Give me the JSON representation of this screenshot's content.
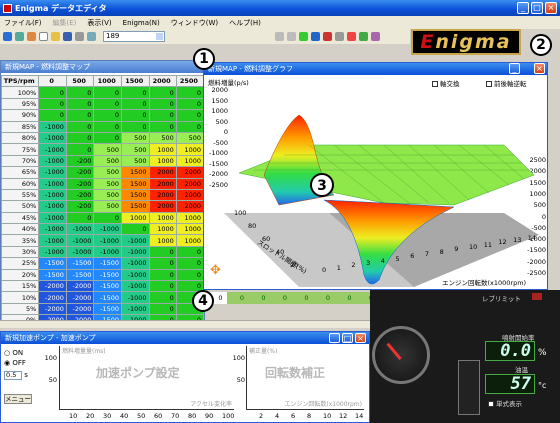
{
  "app": {
    "title": "Enigma データエディタ"
  },
  "menu": [
    {
      "label": "ファイル(F)",
      "disabled": false
    },
    {
      "label": "編集(E)",
      "disabled": true
    },
    {
      "label": "表示(V)",
      "disabled": false
    },
    {
      "label": "Enigma(N)",
      "disabled": false
    },
    {
      "label": "ウィンドウ(W)",
      "disabled": false
    },
    {
      "label": "ヘルプ(H)",
      "disabled": false
    }
  ],
  "toolbar": {
    "combo_value": "189"
  },
  "logo": {
    "text_a": "E",
    "text_b": "nigma"
  },
  "fuel_map": {
    "title": "新規MAP - 燃料調整マップ",
    "corner": "TPS/rpm",
    "columns": [
      "0",
      "500",
      "1000",
      "1500",
      "2000",
      "2500"
    ],
    "rows": [
      {
        "label": "100%",
        "cells": [
          "0",
          "0",
          "0",
          "0",
          "0",
          "0"
        ]
      },
      {
        "label": "95%",
        "cells": [
          "0",
          "0",
          "0",
          "0",
          "0",
          "0"
        ]
      },
      {
        "label": "90%",
        "cells": [
          "0",
          "0",
          "0",
          "0",
          "0",
          "0"
        ]
      },
      {
        "label": "85%",
        "cells": [
          "-1000",
          "0",
          "0",
          "0",
          "0",
          "0"
        ]
      },
      {
        "label": "80%",
        "cells": [
          "-1000",
          "0",
          "0",
          "500",
          "500",
          "500"
        ]
      },
      {
        "label": "75%",
        "cells": [
          "-1000",
          "0",
          "500",
          "500",
          "1000",
          "1000"
        ]
      },
      {
        "label": "70%",
        "cells": [
          "-1000",
          "-200",
          "500",
          "500",
          "1000",
          "1000"
        ]
      },
      {
        "label": "65%",
        "cells": [
          "-1000",
          "-200",
          "500",
          "1500",
          "2000",
          "2000"
        ]
      },
      {
        "label": "60%",
        "cells": [
          "-1000",
          "-200",
          "500",
          "1500",
          "2000",
          "2000"
        ]
      },
      {
        "label": "55%",
        "cells": [
          "-1000",
          "-200",
          "500",
          "1500",
          "2000",
          "2000"
        ]
      },
      {
        "label": "50%",
        "cells": [
          "-1000",
          "-200",
          "500",
          "1500",
          "2000",
          "2000"
        ]
      },
      {
        "label": "45%",
        "cells": [
          "-1000",
          "0",
          "0",
          "1000",
          "1000",
          "1000"
        ]
      },
      {
        "label": "40%",
        "cells": [
          "-1000",
          "-1000",
          "-1000",
          "0",
          "1000",
          "1000"
        ]
      },
      {
        "label": "35%",
        "cells": [
          "-1000",
          "-1000",
          "-1000",
          "-1000",
          "1000",
          "1000"
        ]
      },
      {
        "label": "30%",
        "cells": [
          "-1000",
          "-1000",
          "-1000",
          "-1000",
          "0",
          "0"
        ]
      },
      {
        "label": "25%",
        "cells": [
          "-1500",
          "-1500",
          "-1500",
          "-1000",
          "0",
          "0"
        ]
      },
      {
        "label": "20%",
        "cells": [
          "-1500",
          "-1500",
          "-1500",
          "-1000",
          "0",
          "0"
        ]
      },
      {
        "label": "15%",
        "cells": [
          "-2000",
          "-2000",
          "-1500",
          "-1000",
          "0",
          "0"
        ]
      },
      {
        "label": "10%",
        "cells": [
          "-2000",
          "-2000",
          "-1500",
          "-1000",
          "0",
          "0"
        ]
      },
      {
        "label": "5%",
        "cells": [
          "-2000",
          "-2000",
          "-1500",
          "-1000",
          "0",
          "0"
        ]
      },
      {
        "label": "0%",
        "cells": [
          "-2000",
          "-2000",
          "-1500",
          "-1000",
          "0",
          "0"
        ]
      }
    ]
  },
  "graph": {
    "title": "新規MAP - 燃料調整グラフ",
    "axis_swap": "軸交換",
    "rotate": "前後軸逆転",
    "z_label": "燃料増量(p/s)",
    "z_ticks_left": [
      "2000",
      "1500",
      "1000",
      "500",
      "0",
      "-500",
      "-1000",
      "-1500",
      "-2000",
      "-2500"
    ],
    "z_ticks_right": [
      "2500",
      "2000",
      "1500",
      "1000",
      "500",
      "0",
      "-500",
      "-1000",
      "-1500",
      "-2000",
      "-2500"
    ],
    "y_label": "スロットル開度(%)",
    "y_ticks": [
      "100",
      "80",
      "60",
      "40",
      "20"
    ],
    "x_label": "エンジン回転数(x1000rpm)",
    "x_ticks": [
      "0",
      "1",
      "2",
      "3",
      "4",
      "5",
      "6",
      "7",
      "8",
      "9",
      "10",
      "11",
      "12",
      "13",
      "14"
    ]
  },
  "bottom_row": [
    "0",
    "0",
    "0",
    "0",
    "0",
    "0",
    "0",
    "0",
    "0",
    "0",
    "0",
    "0"
  ],
  "accel": {
    "title": "新規加速ポンプ - 加速ポンプ",
    "on": "ON",
    "off": "OFF",
    "spin_value": "0.5",
    "spin_unit": "s",
    "menu_button": "メニュー",
    "chart1_watermark": "加速ポンプ設定",
    "chart1_ylabel": "燃料増量量(ms)",
    "chart1_yticks": [
      "100",
      "50"
    ],
    "chart1_xlabel": "アクセル変化率",
    "chart1_xticks": [
      "10",
      "20",
      "30",
      "40",
      "50",
      "60",
      "70",
      "80",
      "90",
      "100"
    ],
    "chart2_watermark": "回転数補正",
    "chart2_ylabel": "補正量(%)",
    "chart2_yticks": [
      "100",
      "50"
    ],
    "chart2_xlabel": "エンジン回転数(x1000rpm)",
    "chart2_xticks": [
      "2",
      "4",
      "6",
      "8",
      "10",
      "12",
      "14"
    ]
  },
  "dash": {
    "rev_limit": "レブリミット",
    "injection_label": "噴射開始率",
    "injection_value": "0.0",
    "injection_unit": "%",
    "oil_label": "油温",
    "oil_value": "57",
    "oil_unit": "°c",
    "single_display": "単式表示"
  },
  "callouts": [
    "1",
    "2",
    "3",
    "4"
  ],
  "colors": {
    "green": "#22cc22",
    "light_green": "#99ee55",
    "yellow": "#eeee22",
    "orange": "#ff8800",
    "red": "#ff2200",
    "blue": "#2288ff"
  }
}
